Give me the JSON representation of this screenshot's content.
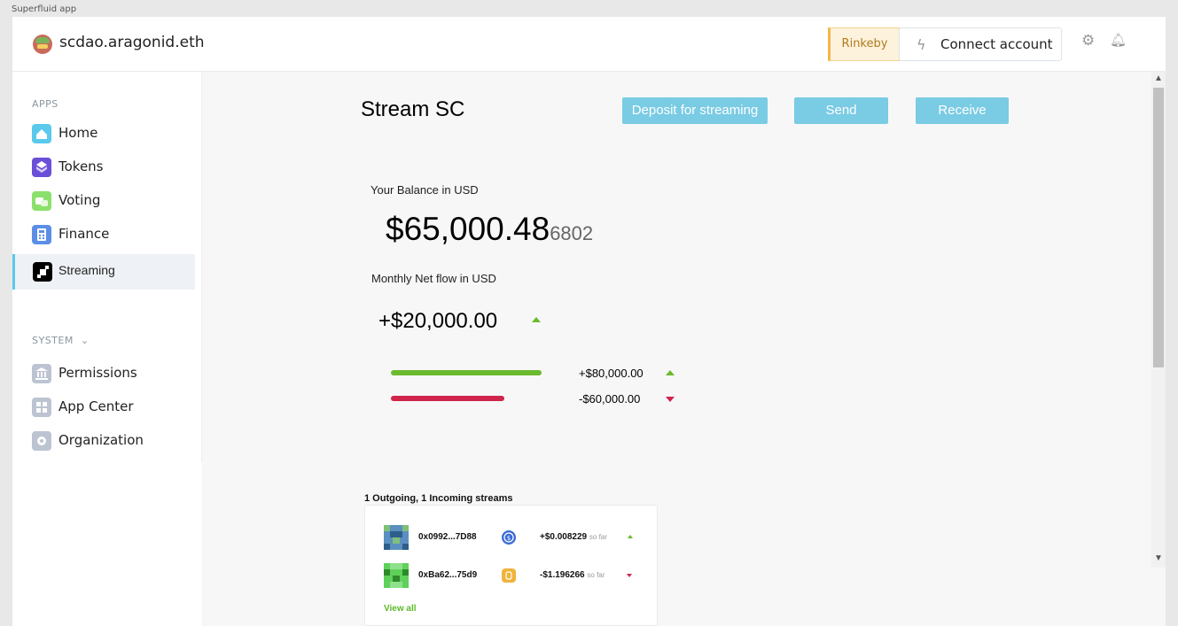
{
  "window": {
    "title": "Superfluid app"
  },
  "header": {
    "org_name": "scdao.aragonid.eth",
    "network": "Rinkeby",
    "connect_label": "Connect account"
  },
  "sidebar": {
    "apps_label": "APPS",
    "apps": [
      {
        "label": "Home",
        "icon": "home-icon"
      },
      {
        "label": "Tokens",
        "icon": "tokens-icon"
      },
      {
        "label": "Voting",
        "icon": "voting-icon"
      },
      {
        "label": "Finance",
        "icon": "finance-icon"
      },
      {
        "label": "Streaming",
        "icon": "streaming-icon",
        "active": true
      }
    ],
    "system_label": "SYSTEM",
    "system": [
      {
        "label": "Permissions",
        "icon": "permissions-icon"
      },
      {
        "label": "App Center",
        "icon": "app-center-icon"
      },
      {
        "label": "Organization",
        "icon": "organization-icon"
      }
    ]
  },
  "main": {
    "title": "Stream SC",
    "deposit_label": "Deposit for streaming",
    "send_label": "Send",
    "receive_label": "Receive",
    "balance_label": "Your Balance in USD",
    "balance_main": "$65,000.48",
    "balance_decimals": "6802",
    "net_flow_label": "Monthly Net flow in USD",
    "net_flow_value": "+$20,000.00",
    "inflow": "+$80,000.00",
    "outflow": "-$60,000.00",
    "inflow_share": 1.0,
    "outflow_share": 0.75
  },
  "streams": {
    "title": "1 Outgoing, 1 Incoming streams",
    "rows": [
      {
        "address": "0x0992...7D88",
        "amount": "+$0.008229",
        "so_far": "so far",
        "direction": "up"
      },
      {
        "address": "0xBa62...75d9",
        "amount": "-$1.196266",
        "so_far": "so far",
        "direction": "down"
      }
    ],
    "view_all": "View all"
  },
  "colors": {
    "accent": "#7acbe4",
    "positive": "#6bba2e",
    "negative": "#d0244a",
    "warning_bg": "#fdf2dc"
  }
}
